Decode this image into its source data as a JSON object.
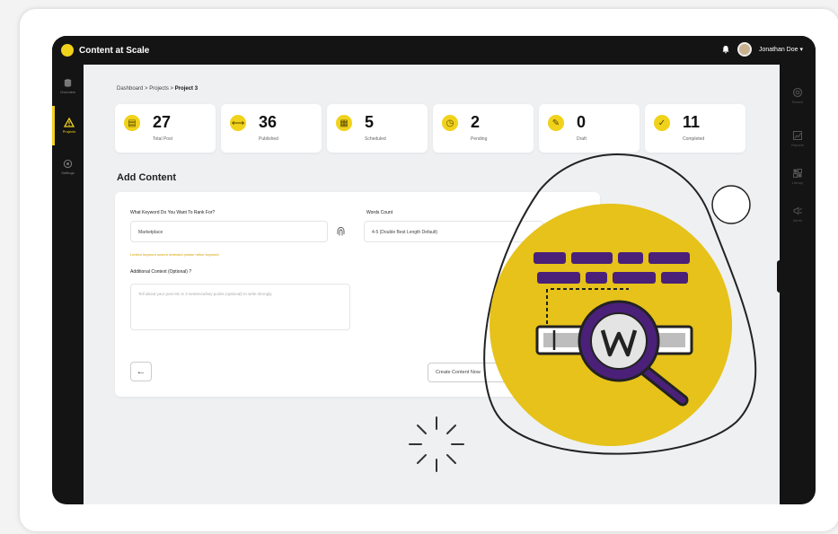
{
  "app": {
    "title": "Content at Scale"
  },
  "user": {
    "name": "Jonathan Doe ▾"
  },
  "breadcrumb": {
    "path": "Dashboard > Projects > ",
    "current": "Project 3"
  },
  "stats": [
    {
      "value": "27",
      "label": "Total Post",
      "icon": "document-icon"
    },
    {
      "value": "36",
      "label": "Published",
      "icon": "broadcast-icon"
    },
    {
      "value": "5",
      "label": "Scheduled",
      "icon": "calendar-icon"
    },
    {
      "value": "2",
      "label": "Pending",
      "icon": "clock-icon"
    },
    {
      "value": "0",
      "label": "Draft",
      "icon": "draft-icon"
    },
    {
      "value": "11",
      "label": "Completed",
      "icon": "check-icon"
    }
  ],
  "leftnav": [
    {
      "label": "Overview",
      "icon": "database-icon"
    },
    {
      "label": "Projects",
      "icon": "warning-triangle-icon",
      "active": true
    },
    {
      "label": "Settings",
      "icon": "gear-icon"
    }
  ],
  "rightnav": [
    {
      "label": "Search",
      "icon": "search-icon"
    },
    {
      "label": "Reports",
      "icon": "chart-icon"
    },
    {
      "label": "Library",
      "icon": "grid-icon"
    },
    {
      "label": "Alerts",
      "icon": "megaphone-icon"
    }
  ],
  "form": {
    "heading": "Add Content",
    "keyword_label": "What Keyword Do You Want To Rank For?",
    "keyword_value": "Marketplace",
    "keyword_hint": "Limited keyword search detected please refine keyword.",
    "words_label": "Words Count",
    "words_value": "4-5 (Double Best Length Default)",
    "context_label": "Additional Context (Optional) ?",
    "context_placeholder": "Tell about your post etc in 3 sentence/key points (optional) to write strongly",
    "create_label": "Create Content Now"
  },
  "colors": {
    "accent": "#f1d21b",
    "purple": "#4a2079",
    "dark": "#141414"
  }
}
